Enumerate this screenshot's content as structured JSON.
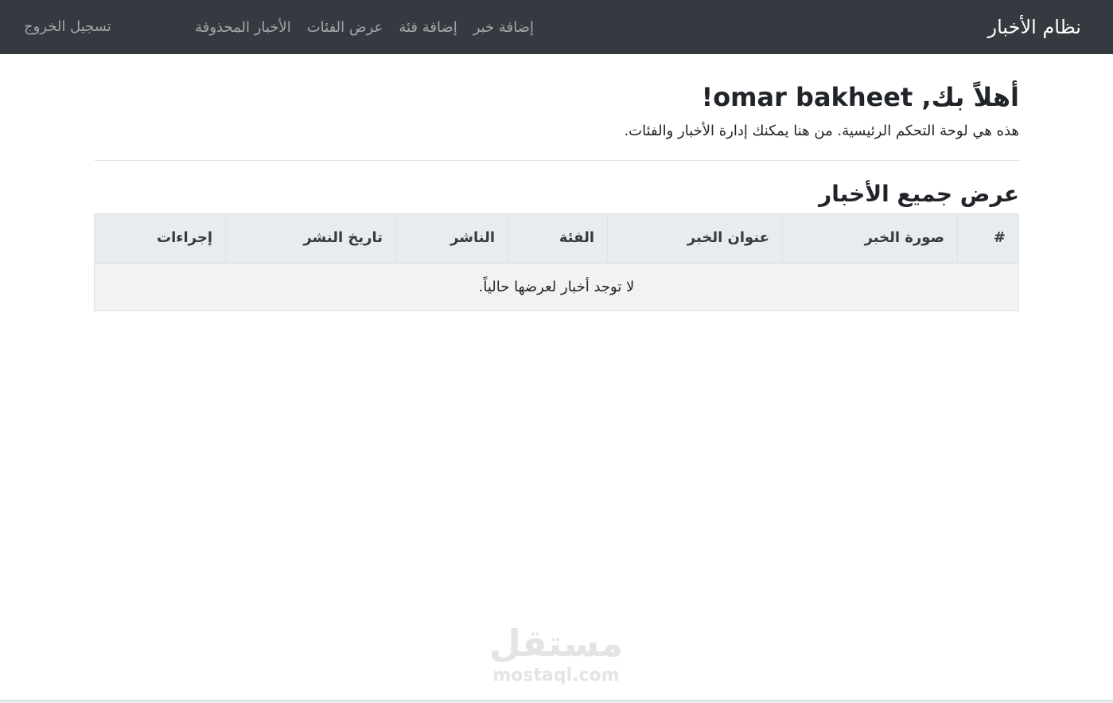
{
  "navbar": {
    "brand": "نظام الأخبار",
    "links": [
      {
        "label": "إضافة خبر"
      },
      {
        "label": "إضافة فئة"
      },
      {
        "label": "عرض الفئات"
      },
      {
        "label": "الأخبار المحذوفة"
      }
    ],
    "logout_label": "تسجيل الخروج"
  },
  "welcome": {
    "title": "أهلاً بك, omar bakheet!",
    "text": "هذه هي لوحة التحكم الرئيسية. من هنا يمكنك إدارة الأخبار والفئات."
  },
  "news_section": {
    "title": "عرض جميع الأخبار",
    "columns": [
      "#",
      "صورة الخبر",
      "عنوان الخبر",
      "الفئة",
      "الناشر",
      "تاريخ النشر",
      "إجراءات"
    ],
    "empty_message": "لا توجد أخبار لعرضها حالياً."
  },
  "watermark": {
    "arabic": "مستقل",
    "latin": "mostaql.com"
  },
  "colors": {
    "navbar_bg": "#343a40",
    "table_header_bg": "#e9ecef",
    "table_body_bg": "#f2f2f2"
  }
}
